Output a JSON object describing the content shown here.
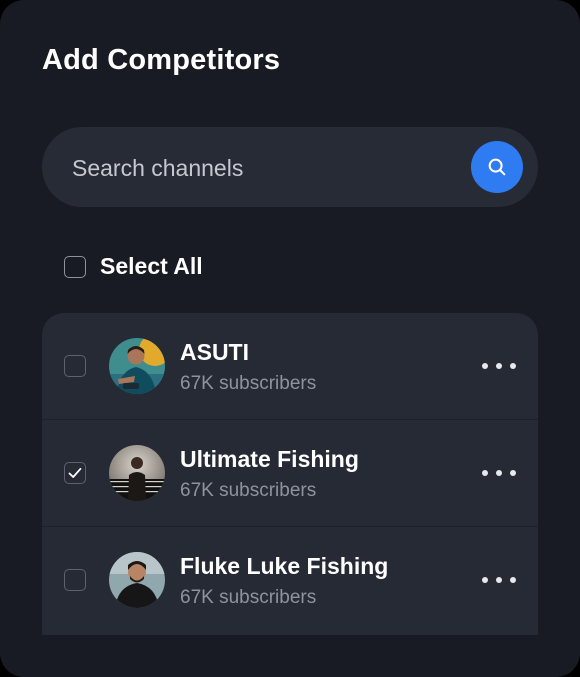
{
  "panel": {
    "title": "Add Competitors"
  },
  "search": {
    "placeholder": "Search channels",
    "value": "",
    "button_icon": "search-icon"
  },
  "select_all": {
    "label": "Select All",
    "checked": false
  },
  "channels": [
    {
      "name": "ASUTI",
      "subscribers": "67K subscribers",
      "checked": false,
      "avatar_icon": "channel-avatar",
      "menu_icon": "more-horizontal-icon"
    },
    {
      "name": "Ultimate Fishing",
      "subscribers": "67K subscribers",
      "checked": true,
      "avatar_icon": "channel-avatar",
      "menu_icon": "more-horizontal-icon"
    },
    {
      "name": "Fluke Luke Fishing",
      "subscribers": "67K subscribers",
      "checked": false,
      "avatar_icon": "channel-avatar",
      "menu_icon": "more-horizontal-icon"
    }
  ],
  "colors": {
    "background": "#181b23",
    "surface": "#262a34",
    "search_surface": "#272b35",
    "accent": "#2f7cf2",
    "text_primary": "#ffffff",
    "text_secondary": "#8f939c"
  }
}
